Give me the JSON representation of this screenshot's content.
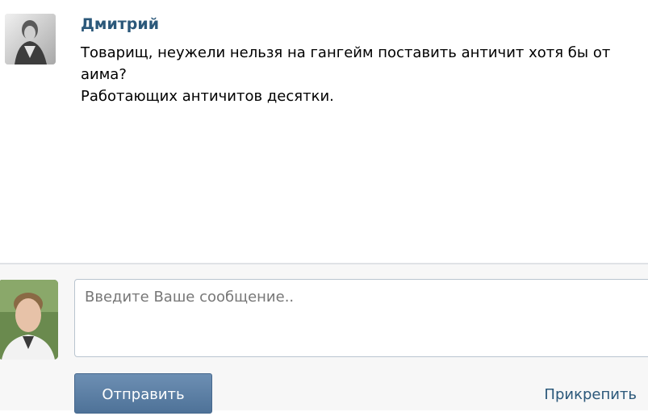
{
  "message": {
    "author": "Дмитрий",
    "lines": [
      "Товарищ, неужели нельзя на гангейм поставить античит хотя бы от",
      "аима?",
      "Работающих античитов десятки."
    ]
  },
  "composer": {
    "placeholder": "Введите Ваше сообщение..",
    "send_label": "Отправить",
    "attach_label": "Прикрепить"
  },
  "colors": {
    "link": "#2b587a",
    "send_button": "#5a7ea5"
  }
}
